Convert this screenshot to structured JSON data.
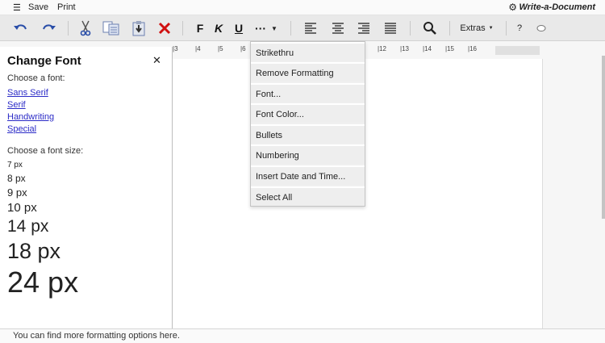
{
  "menubar": {
    "menu_icon": "hamburger-icon",
    "save_label": "Save",
    "print_label": "Print",
    "settings_icon": "gear-icon",
    "app_title": "Write-a-Document"
  },
  "toolbar": {
    "bold_label": "F",
    "italic_label": "K",
    "underline_label": "U",
    "more_label": "···",
    "extras_label": "Extras",
    "help_label": "?",
    "icons": [
      "undo-icon",
      "redo-icon",
      "cut-icon",
      "copy-icon",
      "paste-icon",
      "delete-icon",
      "align-left-icon",
      "align-center-icon",
      "align-right-icon",
      "justify-icon",
      "search-icon",
      "comment-icon"
    ],
    "colors": {
      "blue_icon": "#2a4ea8",
      "delete_red": "#d01010"
    }
  },
  "ruler": {
    "ticks": [
      "3",
      "4",
      "5",
      "6",
      "12",
      "13",
      "14",
      "15",
      "16"
    ]
  },
  "panel": {
    "title": "Change Font",
    "choose_font_label": "Choose a font:",
    "fonts": [
      "Sans Serif",
      "Serif",
      "Handwriting",
      "Special"
    ],
    "choose_size_label": "Choose a font size:",
    "sizes": [
      "7 px",
      "8 px",
      "9 px",
      "10 px",
      "14 px",
      "18 px",
      "24 px"
    ]
  },
  "dropdown": {
    "items": [
      "Strikethru",
      "Remove Formatting",
      "Font...",
      "Font Color...",
      "Bullets",
      "Numbering",
      "Insert Date and Time...",
      "Select All"
    ]
  },
  "status": {
    "text": "You can find more formatting options here."
  }
}
